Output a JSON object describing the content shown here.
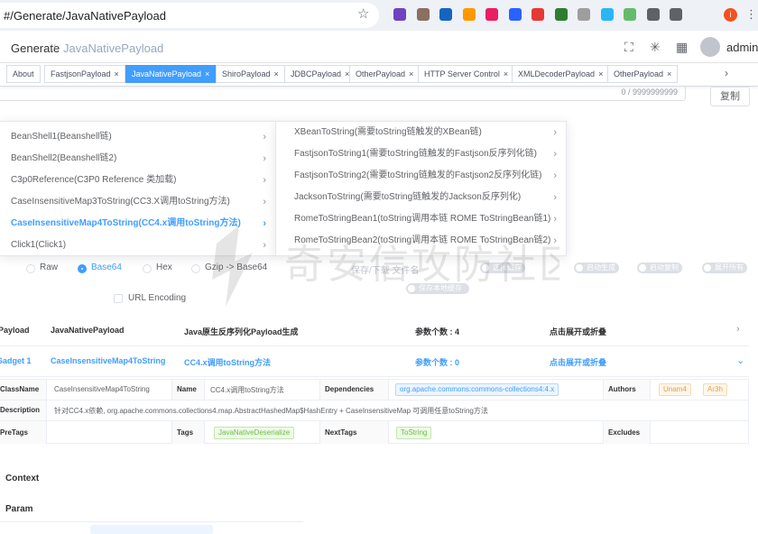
{
  "browser": {
    "url": "#/Generate/JavaNativePayload",
    "profile_initial": "i",
    "extension_icons": [
      "extension-icon",
      "cookie-icon",
      "extension-icon",
      "extension-icon",
      "extension-icon",
      "extension-icon",
      "extension-icon",
      "extension-icon",
      "extension-icon",
      "extension-icon",
      "extension-icon",
      "puzzle-icon",
      "reading-list-icon"
    ]
  },
  "header": {
    "breadcrumb_root": "Generate",
    "breadcrumb_sep": "/",
    "breadcrumb_current": "JavaNativePayload",
    "username": "admin"
  },
  "tabs": [
    {
      "label": "About",
      "closable": false,
      "active": false
    },
    {
      "label": "FastjsonPayload",
      "closable": true,
      "active": false
    },
    {
      "label": "JavaNativePayload",
      "closable": true,
      "active": true
    },
    {
      "label": "ShiroPayload",
      "closable": true,
      "active": false
    },
    {
      "label": "JDBCPayload",
      "closable": true,
      "active": false
    },
    {
      "label": "OtherPayload",
      "closable": true,
      "active": false
    },
    {
      "label": "HTTP Server Control",
      "closable": true,
      "active": false
    },
    {
      "label": "XMLDecoderPayload",
      "closable": true,
      "active": false
    },
    {
      "label": "OtherPayload",
      "closable": true,
      "active": false
    }
  ],
  "tab_close_glyph": "×",
  "textarea": {
    "counter": "0 / 9999999999"
  },
  "copy_button": "复制",
  "cascader": {
    "left": [
      "BeanShell1(Beanshell链)",
      "BeanShell2(Beanshell链2)",
      "C3p0Reference(C3P0 Reference 类加载)",
      "CaseInsensitiveMap3ToString(CC3.X调用toString方法)",
      "CaseInsensitiveMap4ToString(CC4.x调用toString方法)",
      "Click1(Click1)"
    ],
    "left_active_index": 4,
    "right": [
      "XBeanToString(需要toString链触发的XBean链)",
      "FastjsonToString1(需要toString链触发的Fastjson反序列化链)",
      "FastjsonToString2(需要toString链触发的Fastjson2反序列化链)",
      "JacksonToString(需要toString链触发的Jackson反序列化)",
      "RomeToStringBean1(toString调用本链 ROME ToStringBean链1)",
      "RomeToStringBean2(toString调用本链 ROME ToStringBean链2)"
    ]
  },
  "encodings": [
    {
      "label": "Raw",
      "selected": false
    },
    {
      "label": "Base64",
      "selected": true
    },
    {
      "label": "Hex",
      "selected": false
    },
    {
      "label": "Gzip -> Base64",
      "selected": false
    }
  ],
  "save_filename_placeholder": "保存/下载 文件名",
  "switches": [
    "选择缓存",
    "启动生成",
    "启动复制",
    "展开所有",
    "保存本地缓存"
  ],
  "url_encoding_label": "URL Encoding",
  "payload_row": {
    "label": "Payload",
    "name": "JavaNativePayload",
    "desc": "Java原生反序列化Payload生成",
    "param_count": "参数个数 : 4",
    "toggle": "点击展开或折叠"
  },
  "gadget_row": {
    "label": "Gadget 1",
    "name": "CaseInsensitiveMap4ToString",
    "desc": "CC4.x调用toString方法",
    "param_count": "参数个数 : 0",
    "toggle": "点击展开或折叠"
  },
  "details": {
    "classname_label": "ClassName",
    "classname": "CaseInsensitiveMap4ToString",
    "name_label": "Name",
    "name": "CC4.x调用toString方法",
    "dependencies_label": "Dependencies",
    "dependency": "org.apache.commons:commons-collections4:4.x",
    "authors_label": "Authors",
    "authors": [
      "Unam4",
      "Ar3h"
    ],
    "description_label": "Description",
    "description": "针对CC4.x依赖, org.apache.commons.collections4.map.AbstractHashedMap$HashEntry + CaseInsensitiveMap 可调用任意toString方法",
    "pretags_label": "PreTags",
    "tags_label": "Tags",
    "tag": "JavaNativeDeserialize",
    "nexttags_label": "NextTags",
    "nexttag": "ToString",
    "excludes_label": "Excludes"
  },
  "context_label": "Context",
  "param_label": "Param",
  "watermark": "奇安信攻防社区",
  "colors": {
    "primary": "#409eff",
    "tab_active": "#409eff",
    "extension_badge": "#6f42c1",
    "profile": "#f4511e"
  }
}
